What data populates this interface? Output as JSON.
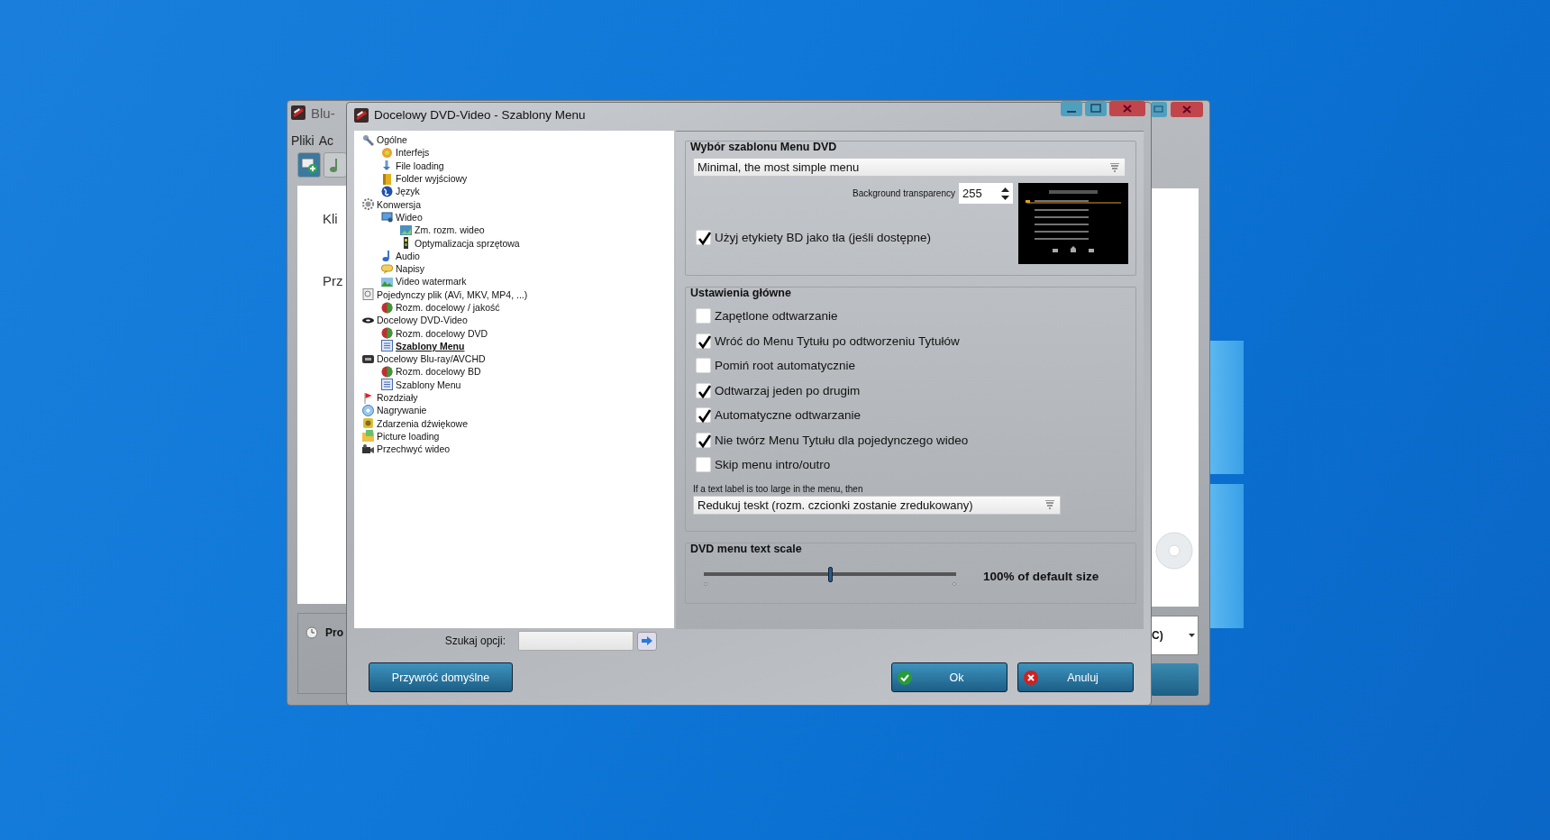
{
  "back_window": {
    "title": "Blu-",
    "menu": [
      "Pliki",
      "Ac"
    ],
    "texts": [
      "Kli",
      "Prz"
    ],
    "status": "Pro",
    "combo": "C)"
  },
  "dialog": {
    "title": "Docelowy DVD-Video - Szablony Menu"
  },
  "tree": [
    {
      "label": "Ogólne",
      "selected": false,
      "children": [
        {
          "label": "Interfejs",
          "selected": false
        },
        {
          "label": "File loading",
          "selected": false
        },
        {
          "label": "Folder wyjściowy",
          "selected": false
        },
        {
          "label": "Język",
          "selected": false
        }
      ]
    },
    {
      "label": "Konwersja",
      "selected": false,
      "children": [
        {
          "label": "Wideo",
          "selected": false,
          "children": [
            {
              "label": "Zm. rozm. wideo",
              "selected": false
            },
            {
              "label": "Optymalizacja sprzętowa",
              "selected": false
            }
          ]
        },
        {
          "label": "Audio",
          "selected": false
        },
        {
          "label": "Napisy",
          "selected": false
        },
        {
          "label": "Video watermark",
          "selected": false
        }
      ]
    },
    {
      "label": "Pojedynczy plik (AVi, MKV, MP4, ...)",
      "selected": false,
      "children": [
        {
          "label": "Rozm. docelowy / jakość",
          "selected": false
        }
      ]
    },
    {
      "label": "Docelowy DVD-Video",
      "selected": false,
      "children": [
        {
          "label": "Rozm. docelowy DVD",
          "selected": false
        },
        {
          "label": "Szablony Menu",
          "selected": true
        }
      ]
    },
    {
      "label": "Docelowy Blu-ray/AVCHD",
      "selected": false,
      "children": [
        {
          "label": "Rozm. docelowy BD",
          "selected": false
        },
        {
          "label": "Szablony Menu",
          "selected": false
        }
      ]
    },
    {
      "label": "Rozdziały",
      "selected": false
    },
    {
      "label": "Nagrywanie",
      "selected": false
    },
    {
      "label": "Zdarzenia dźwiękowe",
      "selected": false
    },
    {
      "label": "Picture loading",
      "selected": false
    },
    {
      "label": "Przechwyć wideo",
      "selected": false
    }
  ],
  "template_group": {
    "title": "Wybór szablonu Menu DVD",
    "template": "Minimal, the most simple menu",
    "transparency_label": "Background transparency",
    "transparency": "255",
    "bd_option": {
      "label": "Użyj etykiety BD jako tła (jeśli dostępne)",
      "checked": true
    }
  },
  "main_settings": {
    "title": "Ustawienia główne",
    "options": [
      {
        "label": "Zapętlone odtwarzanie",
        "checked": false
      },
      {
        "label": "Wróć do Menu Tytułu po odtworzeniu Tytułów",
        "checked": true
      },
      {
        "label": "Pomiń root automatycznie",
        "checked": false
      },
      {
        "label": "Odtwarzaj jeden po drugim",
        "checked": true
      },
      {
        "label": "Automatyczne odtwarzanie",
        "checked": true
      },
      {
        "label": "Nie twórz Menu Tytułu dla pojedynczego wideo",
        "checked": true
      },
      {
        "label": "Skip menu intro/outro",
        "checked": false
      }
    ],
    "overflow_label": "If a text label is too large in the menu, then",
    "overflow_choice": "Redukuj teskt (rozm. czcionki zostanie zredukowany)"
  },
  "text_scale": {
    "title": "DVD menu text scale",
    "level": 0.5,
    "reading": "100% of default size"
  },
  "search": {
    "label": "Szukaj opcji:"
  },
  "buttons": [
    {
      "label": "Przywróć domyślne",
      "kind": "plain"
    },
    {
      "label": "Ok",
      "kind": "ok"
    },
    {
      "label": "Anuluj",
      "kind": "cancel"
    }
  ]
}
